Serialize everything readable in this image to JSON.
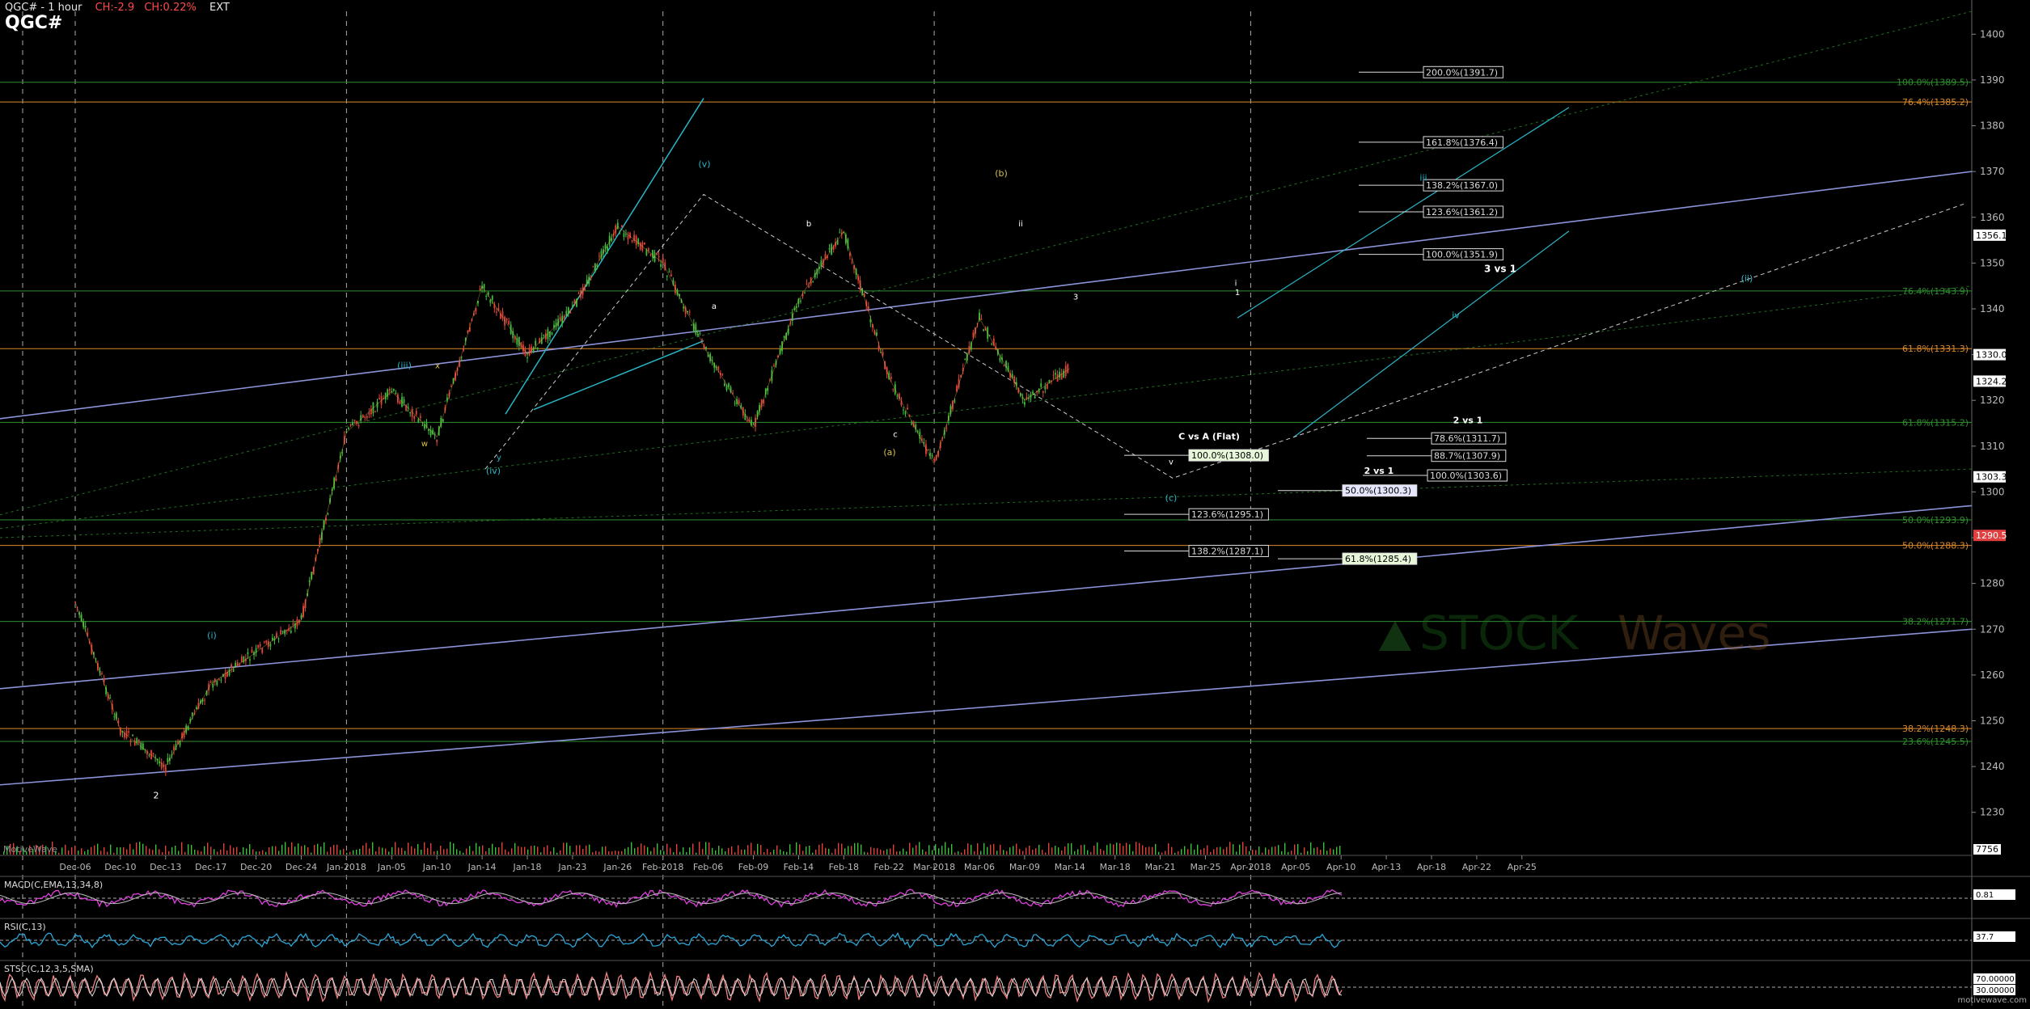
{
  "header": {
    "symbol_timeframe": "QGC# - 1 hour",
    "change": "CH:-2.9",
    "change_pct": "CH:0.22%",
    "session": "EXT",
    "symbol": "QGC#"
  },
  "footer": {
    "brand": "MotiveWave",
    "url": "motivewave.com"
  },
  "watermark": "STOCK Waves",
  "colors": {
    "background": "#000000",
    "up_candle": "#3fbf3f",
    "down_candle": "#e0433a",
    "fib_orange": "#d9892a",
    "fib_green": "#2f8f2f",
    "trend_blue": "#8c93d9",
    "wave_cyan": "#29b6c6",
    "macd": "#e040e0",
    "rsi": "#2aa7d8",
    "stoch": "#f08080"
  },
  "chart_data": [
    {
      "type": "line",
      "title": "QGC# - 1 hour",
      "ylim": [
        1222,
        1405
      ],
      "y_ticks": [
        1230,
        1240,
        1250,
        1260,
        1270,
        1280,
        1290,
        1300,
        1310,
        1320,
        1330,
        1340,
        1350,
        1360,
        1370,
        1380,
        1390,
        1400
      ],
      "x_tick_labels": [
        "Dec-06",
        "Dec-10",
        "Dec-13",
        "Dec-17",
        "Dec-20",
        "Dec-24",
        "Jan-2018",
        "Jan-05",
        "Jan-10",
        "Jan-14",
        "Jan-18",
        "Jan-23",
        "Jan-26",
        "Feb-2018",
        "Feb-06",
        "Feb-09",
        "Feb-14",
        "Feb-18",
        "Feb-22",
        "Mar-2018",
        "Mar-06",
        "Mar-09",
        "Mar-14",
        "Mar-18",
        "Mar-21",
        "Mar-25",
        "Apr-2018",
        "Apr-05",
        "Apr-10",
        "Apr-13",
        "Apr-18",
        "Apr-22",
        "Apr-25"
      ],
      "series": [
        {
          "x": [
            "Dec-06",
            "Dec-10",
            "Dec-13",
            "Dec-17",
            "Dec-20",
            "Dec-24",
            "Jan-2018",
            "Jan-05",
            "Jan-10",
            "Jan-14",
            "Jan-18",
            "Jan-23",
            "Jan-26",
            "Feb-2018",
            "Feb-06",
            "Feb-09",
            "Feb-14",
            "Feb-18",
            "Feb-22",
            "Mar-2018",
            "Mar-06",
            "Mar-09",
            "Mar-14"
          ],
          "values": [
            1276,
            1248,
            1240,
            1258,
            1265,
            1272,
            1313,
            1322,
            1312,
            1345,
            1330,
            1340,
            1358,
            1350,
            1330,
            1314,
            1342,
            1357,
            1325,
            1306,
            1338,
            1320,
            1327
          ]
        }
      ],
      "price_labels": [
        {
          "value": 1356.1,
          "text": "1356.1",
          "bg": "#ffffff",
          "fg": "#000000"
        },
        {
          "value": 1330.0,
          "text": "1330.0",
          "bg": "#ffffff",
          "fg": "#000000"
        },
        {
          "value": 1324.2,
          "text": "1324.2",
          "bg": "#ffffff",
          "fg": "#000000"
        },
        {
          "value": 1303.3,
          "text": "1303.3",
          "bg": "#ffffff",
          "fg": "#000000"
        },
        {
          "value": 1290.5,
          "text": "1290.5",
          "bg": "#e04040",
          "fg": "#ffffff"
        }
      ],
      "fib_lines": [
        {
          "value": 1389.5,
          "color": "#2f8f2f",
          "text": "100.0%(1389.5)"
        },
        {
          "value": 1385.2,
          "color": "#d9892a",
          "text": "76.4%(1385.2)"
        },
        {
          "value": 1343.9,
          "color": "#2f8f2f",
          "text": "76.4%(1343.9)"
        },
        {
          "value": 1331.3,
          "color": "#d9892a",
          "text": "61.8%(1331.3)"
        },
        {
          "value": 1315.2,
          "color": "#2f8f2f",
          "text": "61.8%(1315.2)"
        },
        {
          "value": 1293.9,
          "color": "#2f8f2f",
          "text": "50.0%(1293.9)"
        },
        {
          "value": 1288.3,
          "color": "#d9892a",
          "text": "50.0%(1288.3)"
        },
        {
          "value": 1271.7,
          "color": "#2f8f2f",
          "text": "38.2%(1271.7)"
        },
        {
          "value": 1248.3,
          "color": "#d9892a",
          "text": "38.2%(1248.3)"
        },
        {
          "value": 1245.5,
          "color": "#2f8f2f",
          "text": "23.6%(1245.5)"
        }
      ],
      "target_boxes": [
        {
          "value": 1391.7,
          "text": "200.0%(1391.7)",
          "style": "plain"
        },
        {
          "value": 1376.4,
          "text": "161.8%(1376.4)",
          "style": "plain"
        },
        {
          "value": 1367.0,
          "text": "138.2%(1367.0)",
          "style": "plain"
        },
        {
          "value": 1361.2,
          "text": "123.6%(1361.2)",
          "style": "plain"
        },
        {
          "value": 1351.9,
          "text": "100.0%(1351.9)",
          "style": "plain"
        },
        {
          "value": 1311.7,
          "text": "78.6%(1311.7)",
          "style": "plain"
        },
        {
          "value": 1308.0,
          "text": "100.0%(1308.0)",
          "style": "green"
        },
        {
          "value": 1307.9,
          "text": "88.7%(1307.9)",
          "style": "plain"
        },
        {
          "value": 1303.6,
          "text": "100.0%(1303.6)",
          "style": "plain"
        },
        {
          "value": 1300.3,
          "text": "50.0%(1300.3)",
          "style": "blue"
        },
        {
          "value": 1295.1,
          "text": "123.6%(1295.1)",
          "style": "plain"
        },
        {
          "value": 1287.1,
          "text": "138.2%(1287.1)",
          "style": "plain"
        },
        {
          "value": 1285.4,
          "text": "61.8%(1285.4)",
          "style": "green"
        }
      ],
      "annotations": [
        "3 vs 1",
        "2 vs 1",
        "C vs A (Flat)",
        "2 vs 1",
        "(iii)",
        "(iv)",
        "(v)",
        "(a)",
        "(b)",
        "(c)",
        "(i)",
        "(ii)",
        "iii",
        "iv",
        "i",
        "ii",
        "v",
        "a",
        "b",
        "c",
        "w",
        "x",
        "y",
        "2",
        "1",
        "3"
      ]
    },
    {
      "type": "line",
      "title": "MACD(C,EMA,13,34,8)",
      "y_labels": [
        {
          "text": "0.81"
        }
      ]
    },
    {
      "type": "line",
      "title": "RSI(C,13)",
      "y_labels": [
        {
          "text": "37.7"
        }
      ]
    },
    {
      "type": "line",
      "title": "STSC(C,12,3,5,SMA)",
      "y_labels": [
        {
          "text": "70.00000"
        },
        {
          "text": "30.00000"
        }
      ]
    }
  ],
  "volume_label": "7756"
}
